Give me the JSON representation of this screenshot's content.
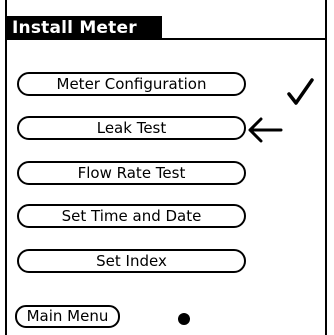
{
  "screen": {
    "title": "Install Meter"
  },
  "menu": {
    "items": [
      {
        "label": "Meter Configuration",
        "status": "completed (checkmark)"
      },
      {
        "label": "Leak Test",
        "status": "current (arrow pointer)"
      },
      {
        "label": "Flow Rate Test"
      },
      {
        "label": "Set Time and Date"
      },
      {
        "label": "Set Index"
      }
    ]
  },
  "footer": {
    "main_menu_label": "Main Menu"
  },
  "icons": {
    "completed": "checkmark-icon",
    "current": "left-arrow-icon",
    "indicator": "dot-icon"
  },
  "colors": {
    "foreground": "#000000",
    "background": "#ffffff",
    "title_text": "#ffffff"
  }
}
